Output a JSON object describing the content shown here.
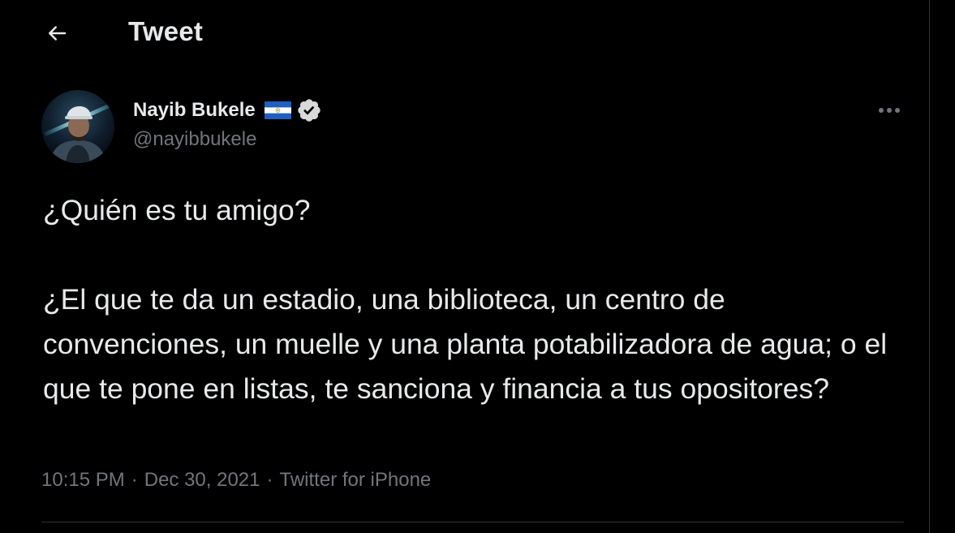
{
  "header": {
    "title": "Tweet",
    "back_icon": "back-arrow-icon"
  },
  "author": {
    "name": "Nayib Bukele",
    "handle": "@nayibbukele",
    "flag_icon": "el-salvador-flag-icon",
    "verified_icon": "verified-badge-icon"
  },
  "tweet": {
    "text": "¿Quién es tu amigo?\n\n¿El que te da un estadio, una biblioteca, un centro de convenciones, un muelle y una planta potabilizadora de agua; o el que te pone en listas, te sanciona y financia a tus opositores?",
    "time": "10:15 PM",
    "date": "Dec 30, 2021",
    "source": "Twitter for iPhone",
    "separator": "·"
  },
  "more_icon": "more-options-icon",
  "colors": {
    "background": "#000000",
    "text": "#e7e9ea",
    "secondary_text": "#71767b",
    "divider": "#2f3336"
  }
}
